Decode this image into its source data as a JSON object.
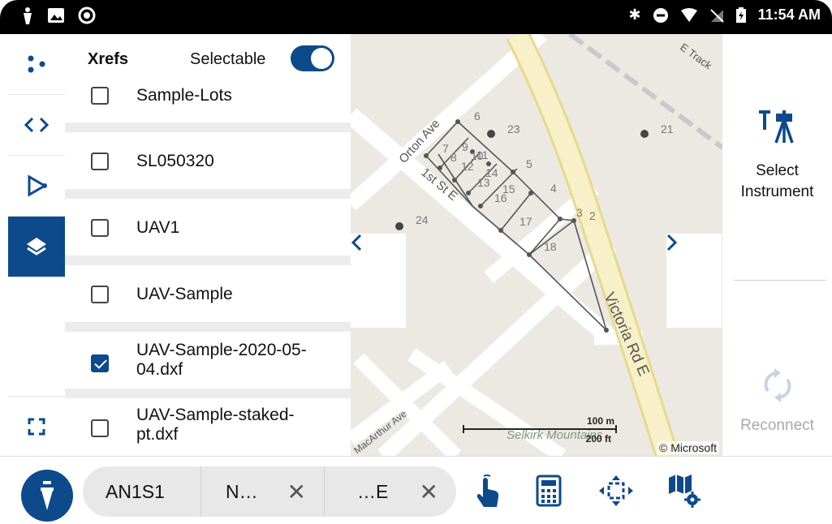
{
  "status_bar": {
    "time": "11:54 AM",
    "icons": [
      "bluetooth-icon",
      "do-not-disturb-icon",
      "wifi-icon",
      "no-signal-icon",
      "battery-icon"
    ]
  },
  "left_rail": {
    "items": [
      "dots-icon",
      "code-icon",
      "vertex-icon",
      "layers-icon",
      "fullscreen-icon"
    ],
    "active": "layers-icon"
  },
  "xrefs_panel": {
    "title": "Xrefs",
    "selectable_label": "Selectable",
    "selectable_on": true,
    "items": [
      {
        "label": "Sample-Lots",
        "checked": false
      },
      {
        "label": "SL050320",
        "checked": false
      },
      {
        "label": "UAV1",
        "checked": false
      },
      {
        "label": "UAV-Sample",
        "checked": false
      },
      {
        "label": "UAV-Sample-2020-05-04.dxf",
        "line1": "UAV-Sample-2020-05-",
        "line2": "04.dxf",
        "checked": true
      },
      {
        "label": "UAV-Sample-staked-pt.dxf",
        "line1": "UAV-Sample-staked-",
        "line2": "pt.dxf",
        "checked": false
      }
    ]
  },
  "map": {
    "streets": [
      "Orton Ave",
      "1st St E",
      "Victoria Rd E",
      "MacArthur Ave",
      "E Track",
      "Selkirk Mountains"
    ],
    "point_labels": [
      "6",
      "23",
      "21",
      "7",
      "8",
      "9",
      "10",
      "11",
      "12",
      "5",
      "14",
      "13",
      "15",
      "16",
      "4",
      "3",
      "2",
      "24",
      "17",
      "18"
    ],
    "scale_top": "100 m",
    "scale_bottom": "200 ft",
    "copyright": "© Microsoft",
    "prev_label": "‹",
    "next_label": "›"
  },
  "right_panel": {
    "select_instrument_line1": "Select",
    "select_instrument_line2": "Instrument",
    "reconnect_label": "Reconnect"
  },
  "bottom_bar": {
    "coordinate_name": "AN1S1",
    "northing": "N…",
    "easting": "…E",
    "tools": [
      "tap-icon",
      "calculator-icon",
      "zoom-extents-icon",
      "map-settings-icon"
    ]
  },
  "colors": {
    "primary": "#0c4a8c",
    "map_bg": "#ece9e3",
    "road_major": "#f4e9b8"
  }
}
